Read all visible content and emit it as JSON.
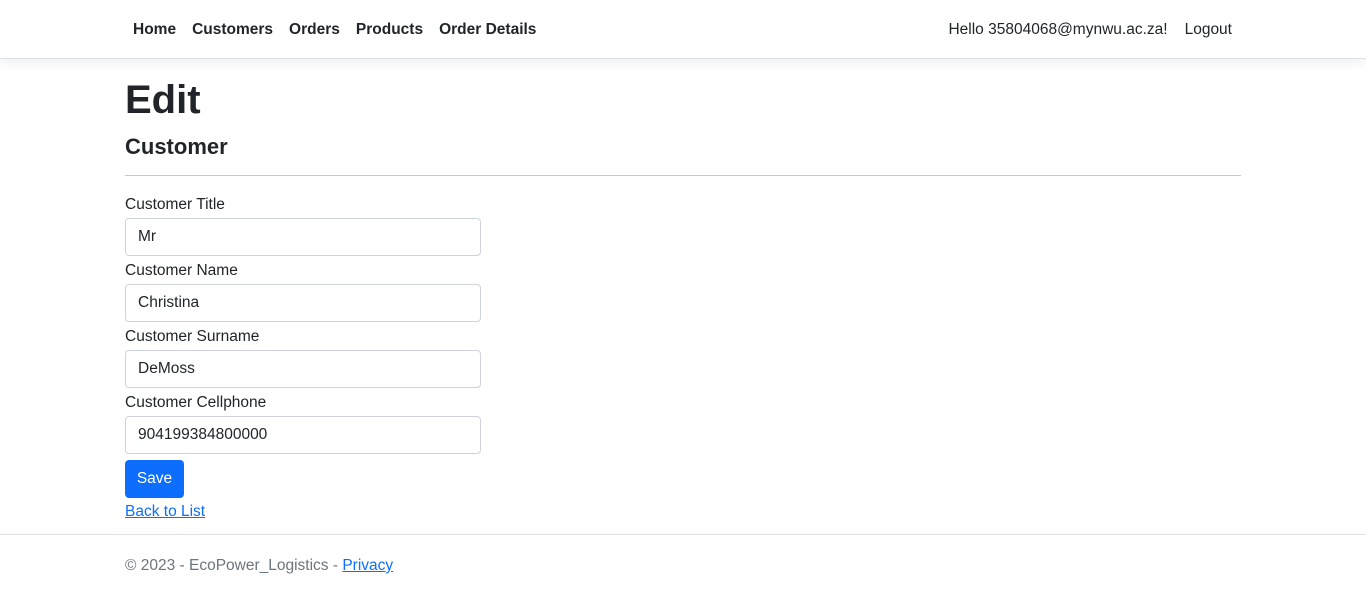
{
  "nav": {
    "links": [
      "Home",
      "Customers",
      "Orders",
      "Products",
      "Order Details"
    ],
    "greeting": "Hello 35804068@mynwu.ac.za!",
    "logout": "Logout"
  },
  "page": {
    "title": "Edit",
    "subtitle": "Customer"
  },
  "form": {
    "fields": [
      {
        "label": "Customer Title",
        "value": "Mr"
      },
      {
        "label": "Customer Name",
        "value": "Christina"
      },
      {
        "label": "Customer Surname",
        "value": "DeMoss"
      },
      {
        "label": "Customer Cellphone",
        "value": "904199384800000"
      }
    ],
    "save_label": "Save",
    "back_link": "Back to List"
  },
  "footer": {
    "text": "© 2023 - EcoPower_Logistics - ",
    "privacy": "Privacy"
  },
  "colors": {
    "primary": "#0d6efd",
    "text": "#212529",
    "muted": "#6c757d"
  }
}
